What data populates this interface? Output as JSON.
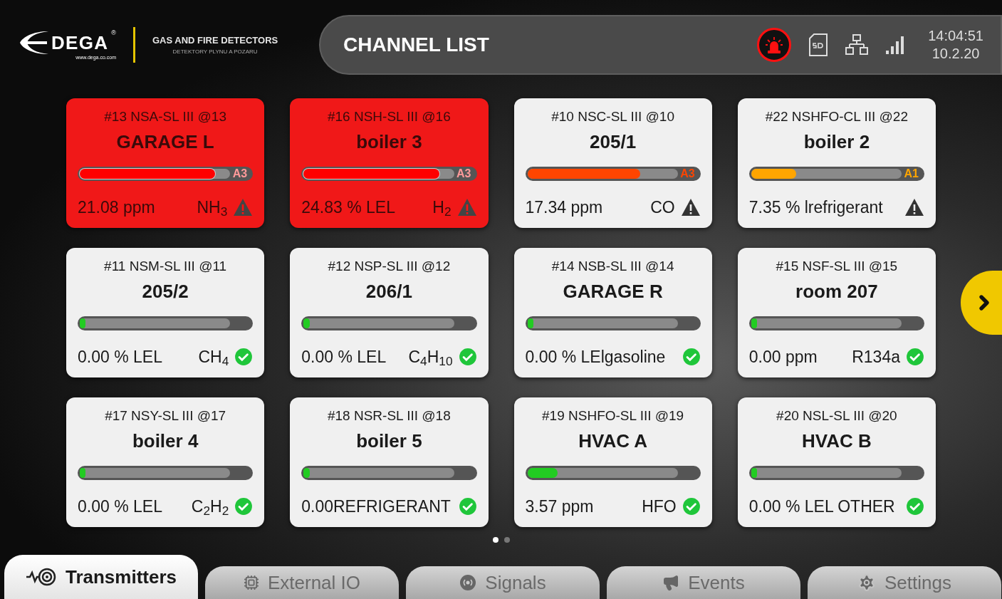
{
  "brand": {
    "logo": "DEGA",
    "registered": "®",
    "website": "www.dega.co.com",
    "tagline": "GAS AND FIRE DETECTORS",
    "tagline_local": "DETEKTORY PLYNU A POZARU"
  },
  "header": {
    "title": "CHANNEL LIST",
    "alarm_active": true,
    "time": "14:04:51",
    "date": "10.2.20"
  },
  "channels": [
    {
      "device": "#13 NSA-SL III @13",
      "name": "GARAGE L",
      "alarm": true,
      "level": 0.9,
      "color": "#ff0000",
      "alarm_label": "A3",
      "reading": "21.08 ppm",
      "gas": "NH$_{3}$",
      "kind": "warning"
    },
    {
      "device": "#16 NSH-SL III @16",
      "name": "boiler 3",
      "alarm": true,
      "level": 0.9,
      "color": "#ff0000",
      "alarm_label": "A3",
      "reading": "24.83 % LEL",
      "gas": "H$_{2}$",
      "kind": "warning"
    },
    {
      "device": "#10 NSC-SL III @10",
      "name": "205/1",
      "alarm": false,
      "level": 0.75,
      "color": "#ff4500",
      "alarm_label": "A3",
      "reading": "17.34 ppm",
      "gas": "CO",
      "kind": "warning"
    },
    {
      "device": "#22 NSHFO-CL III @22",
      "name": "boiler 2",
      "alarm": false,
      "level": 0.3,
      "color": "#ffa500",
      "alarm_label": "A1",
      "reading": "7.35 % lrefrigerant",
      "kind": "warning"
    },
    {
      "device": "#11 NSM-SL III @11",
      "name": "205/2",
      "alarm": false,
      "level": 0.03,
      "color": "#22cc22",
      "reading": "0.00 % LEL",
      "gas": "CH$_{4}$",
      "kind": "ok"
    },
    {
      "device": "#12 NSP-SL III @12",
      "name": "206/1",
      "alarm": false,
      "level": 0.03,
      "color": "#22cc22",
      "reading": "0.00 % LEL",
      "gas": "C$_{4}$H$_{10}$",
      "kind": "ok"
    },
    {
      "device": "#14 NSB-SL III @14",
      "name": "GARAGE R",
      "alarm": false,
      "level": 0.03,
      "color": "#22cc22",
      "reading": "0.00 % LElgasoline",
      "kind": "ok"
    },
    {
      "device": "#15 NSF-SL III @15",
      "name": "room 207",
      "alarm": false,
      "level": 0.03,
      "color": "#22cc22",
      "reading": "0.00 ppm",
      "gas": "R134a",
      "kind": "ok"
    },
    {
      "device": "#17 NSY-SL III @17",
      "name": "boiler 4",
      "alarm": false,
      "level": 0.03,
      "color": "#22cc22",
      "reading": "0.00 % LEL",
      "gas": "C$_{2}$H$_{2}$",
      "kind": "ok"
    },
    {
      "device": "#18 NSR-SL III @18",
      "name": "boiler 5",
      "alarm": false,
      "level": 0.03,
      "color": "#22cc22",
      "reading": "0.00REFRIGERANT",
      "kind": "ok"
    },
    {
      "device": "#19 NSHFO-SL III @19",
      "name": "HVAC A",
      "alarm": false,
      "level": 0.2,
      "color": "#22cc22",
      "reading": "3.57 ppm",
      "gas": "HFO",
      "kind": "ok"
    },
    {
      "device": "#20 NSL-SL III @20",
      "name": "HVAC B",
      "alarm": false,
      "level": 0.03,
      "color": "#22cc22",
      "reading": "0.00 % LEL OTHER",
      "kind": "ok"
    }
  ],
  "pages": [
    {
      "selected": true
    },
    {
      "selected": false
    }
  ],
  "tabs": [
    {
      "label": "Transmitters",
      "kind": "transmitters",
      "selected": true
    },
    {
      "label": "External IO",
      "kind": "io",
      "selected": false
    },
    {
      "label": "Signals",
      "kind": "signals",
      "selected": false
    },
    {
      "label": "Events",
      "kind": "events",
      "selected": false
    },
    {
      "label": "Settings",
      "kind": "settings",
      "selected": false
    }
  ]
}
